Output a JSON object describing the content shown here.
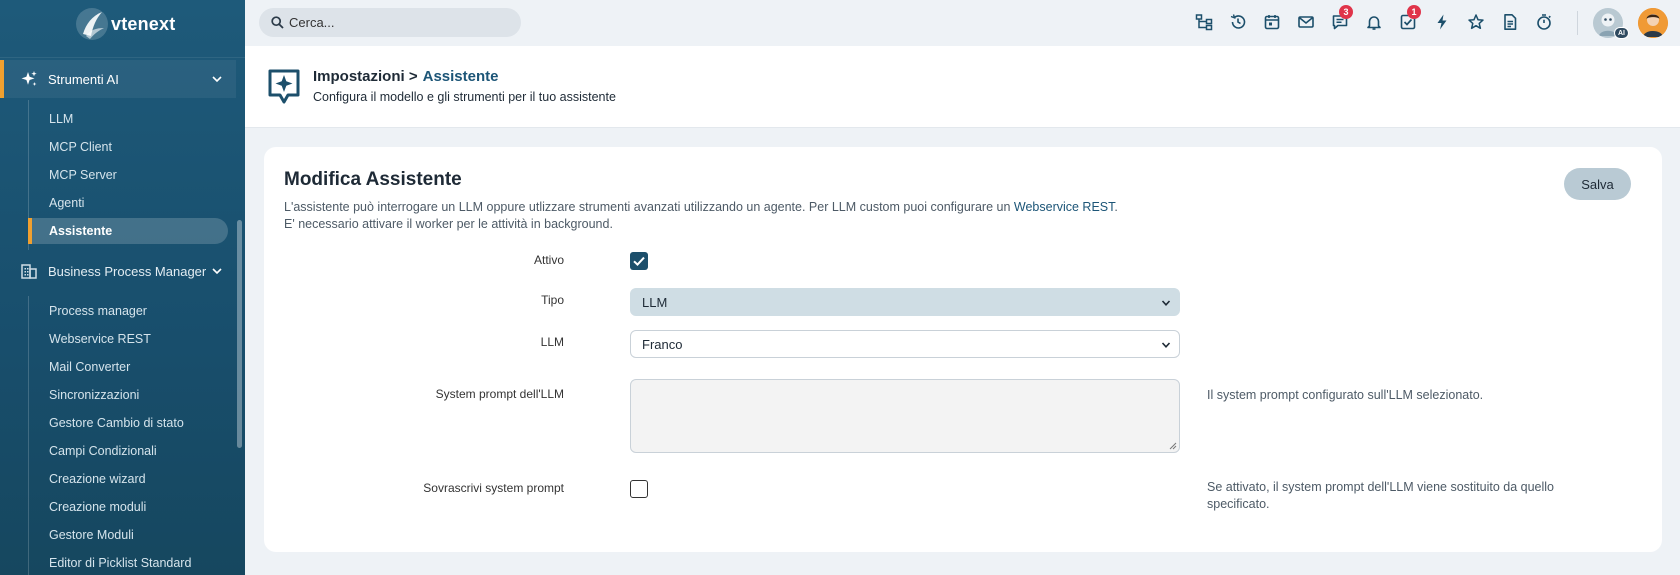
{
  "app": {
    "brand": "vtenext"
  },
  "colors": {
    "sidebar": "#1e5a7a",
    "accent": "#f0a030",
    "primary": "#1c4f6b",
    "badge": "#e0344a"
  },
  "sidebar": {
    "sections": [
      {
        "label": "Strumenti AI",
        "icon": "sparkles-icon",
        "expanded": true,
        "items": [
          {
            "label": "LLM"
          },
          {
            "label": "MCP Client"
          },
          {
            "label": "MCP Server"
          },
          {
            "label": "Agenti"
          },
          {
            "label": "Assistente",
            "selected": true
          }
        ]
      },
      {
        "label": "Business Process Manager",
        "icon": "building-icon",
        "expanded": true,
        "items": [
          {
            "label": "Process manager"
          },
          {
            "label": "Webservice REST"
          },
          {
            "label": "Mail Converter"
          },
          {
            "label": "Sincronizzazioni"
          },
          {
            "label": "Gestore Cambio di stato"
          },
          {
            "label": "Campi Condizionali"
          },
          {
            "label": "Creazione wizard"
          },
          {
            "label": "Creazione moduli"
          },
          {
            "label": "Gestore Moduli"
          },
          {
            "label": "Editor di Picklist Standard"
          }
        ]
      }
    ]
  },
  "topbar": {
    "search_placeholder": "Cerca...",
    "icons": [
      "hierarchy-icon",
      "history-icon",
      "calendar-icon",
      "mail-icon",
      "chat-icon",
      "bell-icon",
      "task-icon",
      "flash-icon",
      "star-icon",
      "document-icon",
      "timer-icon"
    ],
    "chat_badge": "3",
    "task_badge": "1",
    "ai_tag": "AI"
  },
  "header": {
    "breadcrumb_parent": "Impostazioni >",
    "breadcrumb_current": "Assistente",
    "subtitle": "Configura il modello e gli strumenti per il tuo assistente"
  },
  "card": {
    "title": "Modifica Assistente",
    "save_label": "Salva",
    "desc_line1_before": "L'assistente può interrogare un LLM oppure utlizzare strumenti avanzati utilizzando un agente. Per LLM custom puoi configurare un ",
    "desc_link": "Webservice REST",
    "desc_line1_after": ".",
    "desc_line2": "E' necessario attivare il worker per le attività in background.",
    "form": {
      "attivo_label": "Attivo",
      "attivo_checked": true,
      "tipo_label": "Tipo",
      "tipo_value": "LLM",
      "llm_label": "LLM",
      "llm_value": "Franco",
      "system_prompt_label": "System prompt dell'LLM",
      "system_prompt_help": "Il system prompt configurato sull'LLM selezionato.",
      "override_label": "Sovrascrivi system prompt",
      "override_checked": false,
      "override_help": "Se attivato, il system prompt dell'LLM viene sostituito da quello specificato."
    }
  }
}
